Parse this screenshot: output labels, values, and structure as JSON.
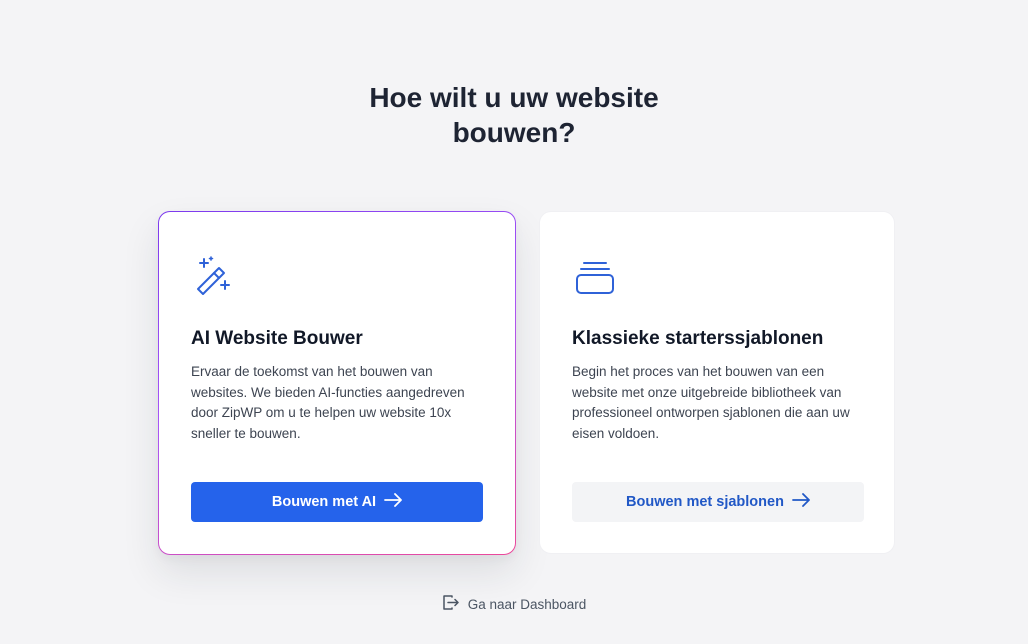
{
  "heading": {
    "line1": "Hoe wilt u uw website",
    "line2": "bouwen?"
  },
  "cards": [
    {
      "icon": "magic-wand-icon",
      "title": "AI Website Bouwer",
      "description": "Ervaar de toekomst van het bouwen van websites. We bieden AI-functies aangedreven door ZipWP om u te helpen uw website 10x sneller te bouwen.",
      "button_label": "Bouwen met AI",
      "button_icon": "arrow-right-icon"
    },
    {
      "icon": "template-stack-icon",
      "title": "Klassieke starterssjablonen",
      "description": "Begin het proces van het bouwen van een website met onze uitgebreide bibliotheek van professioneel ontworpen sjablonen die aan uw eisen voldoen.",
      "button_label": "Bouwen met sjablonen",
      "button_icon": "arrow-right-icon"
    }
  ],
  "dashboard_link": {
    "label": "Ga naar Dashboard",
    "icon": "exit-icon"
  },
  "colors": {
    "background": "#f4f4f6",
    "primary": "#2563eb",
    "icon_blue": "#2f62d8",
    "card_border_gradient": [
      "#7c3aed",
      "#ec4899"
    ]
  }
}
